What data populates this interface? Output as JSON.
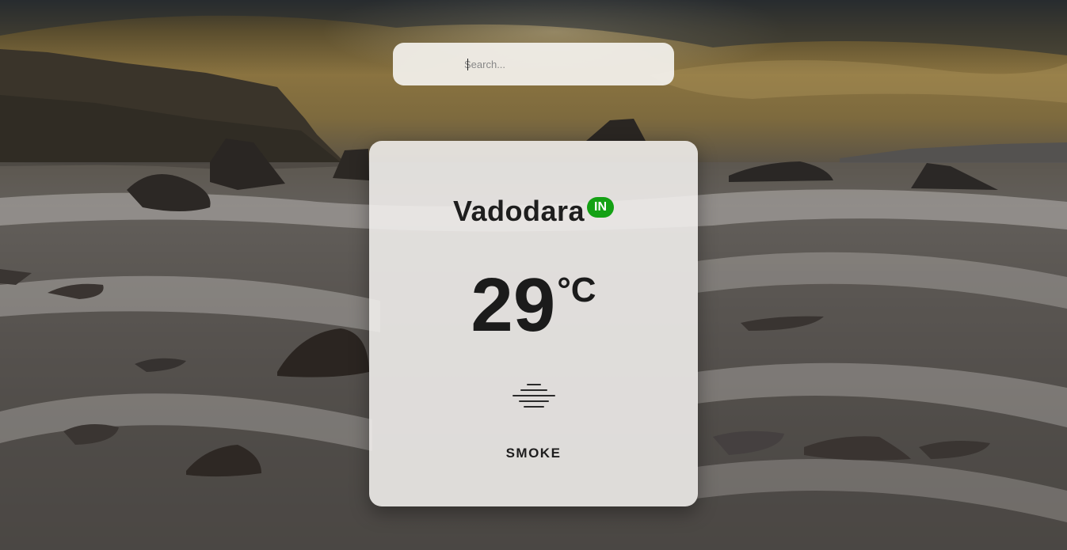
{
  "search": {
    "placeholder": "Search...",
    "value": ""
  },
  "weather": {
    "city": "Vadodara",
    "country": "IN",
    "temperature": "29",
    "unit": "°C",
    "condition": "SMOKE",
    "icon": "smoke-haze-icon"
  },
  "colors": {
    "badge": "#14a114",
    "card": "#f2f0ee",
    "text": "#1e1e1e"
  }
}
